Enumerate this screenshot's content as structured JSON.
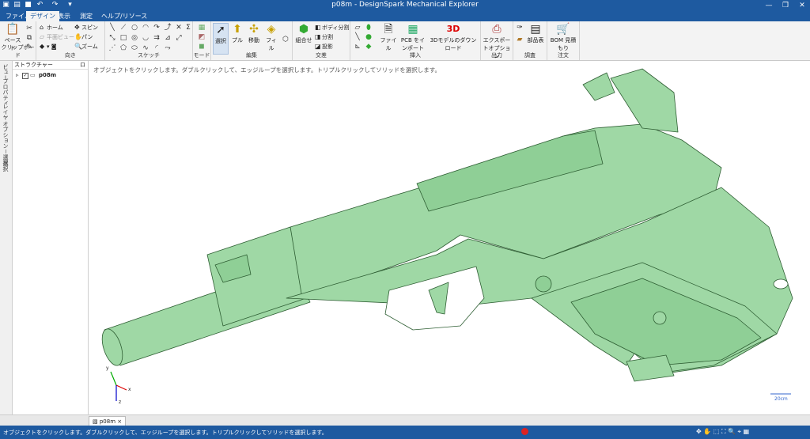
{
  "app": {
    "title": "p08m - DesignSpark Mechanical Explorer"
  },
  "tabs": [
    "ファイル",
    "デザイン",
    "表示",
    "測定",
    "ヘルプ/リソース"
  ],
  "active_tab_index": 1,
  "ribbon": {
    "clipboard": {
      "paste": "ペースト",
      "label": "クリップボード"
    },
    "orient": {
      "home": "ホーム",
      "plane": "平面ビュー",
      "spin": "スピン",
      "pan": "パン",
      "zoom": "ズーム",
      "label": "向き"
    },
    "sketch": {
      "label": "スケッチ"
    },
    "mode": {
      "label": "モード"
    },
    "edit": {
      "select": "選択",
      "pull": "プル",
      "move": "移動",
      "fill": "フィル",
      "label": "編集"
    },
    "intersect": {
      "combine": "組合せ",
      "split_body": "ボディ分割",
      "split": "分割",
      "project": "投影",
      "label": "交差"
    },
    "insert": {
      "file": "ファイル",
      "pcb": "PCB をインポート",
      "model3d": "3Dモデルのダウンロード",
      "label": "挿入"
    },
    "output": {
      "export": "エクスポートオプション",
      "label": "出力"
    },
    "investigate": {
      "parts": "部品表",
      "label": "調査"
    },
    "order": {
      "bom": "BOM 見積もり",
      "label": "注文"
    }
  },
  "left_tabs": [
    "ビュー",
    "プロパティ",
    "レイヤ",
    "オプション－選択",
    "選択"
  ],
  "structure": {
    "header": "ストラクチャー",
    "pin": "ロ",
    "root": "p08m"
  },
  "viewport": {
    "hint": "オブジェクトをクリックします。ダブルクリックして、エッジループを選択します。トリプルクリックしてソリッドを選択します。",
    "scale_label": "20cm",
    "axes": {
      "x": "x",
      "y": "y",
      "z": "z"
    }
  },
  "doc_tab": "p08m",
  "status": {
    "text": "オブジェクトをクリックします。ダブルクリックして、エッジループを選択します。トリプルクリックしてソリッドを選択します。"
  },
  "colors": {
    "accent": "#1e5aa0",
    "model_fill": "#9fd8a5",
    "model_edge": "#2e5e33"
  }
}
